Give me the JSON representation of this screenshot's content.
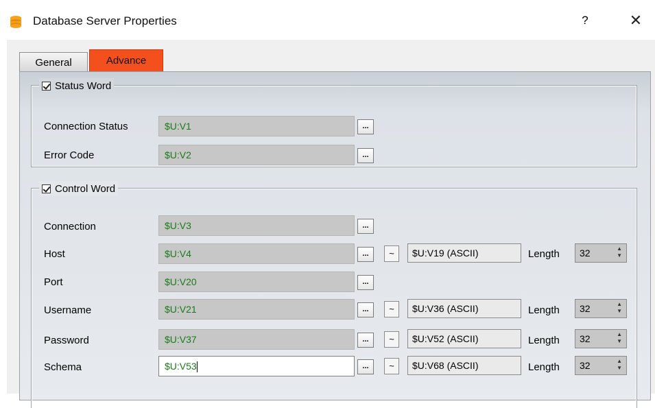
{
  "window": {
    "title": "Database Server Properties",
    "help": "?",
    "close": "✕"
  },
  "tabs": [
    {
      "label": "General"
    },
    {
      "label": "Advance"
    }
  ],
  "status_word": {
    "legend": "Status Word",
    "rows": [
      {
        "label": "Connection Status",
        "value": "$U:V1",
        "button": "..."
      },
      {
        "label": "Error Code",
        "value": "$U:V2",
        "button": "..."
      }
    ]
  },
  "control_word": {
    "legend": "Control Word",
    "length_label": "Length",
    "tilde": "~",
    "rows": [
      {
        "label": "Connection",
        "value": "$U:V3",
        "button": "..."
      },
      {
        "label": "Host",
        "value": "$U:V4",
        "button": "...",
        "range": "$U:V19 (ASCII)",
        "length": "32"
      },
      {
        "label": "Port",
        "value": "$U:V20",
        "button": "..."
      },
      {
        "label": "Username",
        "value": "$U:V21",
        "button": "...",
        "range": "$U:V36 (ASCII)",
        "length": "32"
      },
      {
        "label": "Password",
        "value": "$U:V37",
        "button": "...",
        "range": "$U:V52 (ASCII)",
        "length": "32"
      },
      {
        "label": "Schema",
        "value": "$U:V53",
        "button": "...",
        "range": "$U:V68 (ASCII)",
        "length": "32"
      }
    ]
  },
  "colors": {
    "active_tab": "#f4501e",
    "field_text": "#1a7a1a",
    "field_bg": "#c7c7c7"
  },
  "icons": {
    "app": "database-icon",
    "checkbox": "checkmark-icon"
  }
}
